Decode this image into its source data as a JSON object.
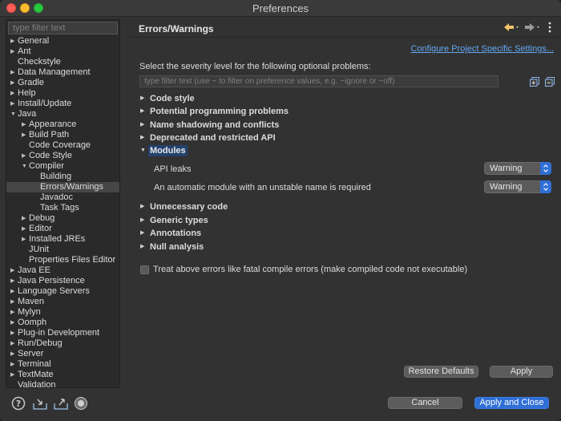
{
  "window": {
    "title": "Preferences"
  },
  "sidebar": {
    "filter_placeholder": "type filter text",
    "items": [
      {
        "label": "General",
        "arrow": "right"
      },
      {
        "label": "Ant",
        "arrow": "right"
      },
      {
        "label": "Checkstyle",
        "arrow": ""
      },
      {
        "label": "Data Management",
        "arrow": "right"
      },
      {
        "label": "Gradle",
        "arrow": "right"
      },
      {
        "label": "Help",
        "arrow": "right"
      },
      {
        "label": "Install/Update",
        "arrow": "right"
      },
      {
        "label": "Java",
        "arrow": "down"
      },
      {
        "label": "Appearance",
        "arrow": "right"
      },
      {
        "label": "Build Path",
        "arrow": "right"
      },
      {
        "label": "Code Coverage",
        "arrow": ""
      },
      {
        "label": "Code Style",
        "arrow": "right"
      },
      {
        "label": "Compiler",
        "arrow": "down"
      },
      {
        "label": "Building",
        "arrow": ""
      },
      {
        "label": "Errors/Warnings",
        "arrow": ""
      },
      {
        "label": "Javadoc",
        "arrow": ""
      },
      {
        "label": "Task Tags",
        "arrow": ""
      },
      {
        "label": "Debug",
        "arrow": "right"
      },
      {
        "label": "Editor",
        "arrow": "right"
      },
      {
        "label": "Installed JREs",
        "arrow": "right"
      },
      {
        "label": "JUnit",
        "arrow": ""
      },
      {
        "label": "Properties Files Editor",
        "arrow": ""
      },
      {
        "label": "Java EE",
        "arrow": "right"
      },
      {
        "label": "Java Persistence",
        "arrow": "right"
      },
      {
        "label": "Language Servers",
        "arrow": "right"
      },
      {
        "label": "Maven",
        "arrow": "right"
      },
      {
        "label": "Mylyn",
        "arrow": "right"
      },
      {
        "label": "Oomph",
        "arrow": "right"
      },
      {
        "label": "Plug-in Development",
        "arrow": "right"
      },
      {
        "label": "Run/Debug",
        "arrow": "right"
      },
      {
        "label": "Server",
        "arrow": "right"
      },
      {
        "label": "Terminal",
        "arrow": "right"
      },
      {
        "label": "TextMate",
        "arrow": "right"
      },
      {
        "label": "Validation",
        "arrow": ""
      }
    ]
  },
  "main": {
    "title": "Errors/Warnings",
    "config_link": "Configure Project Specific Settings...",
    "severity_text": "Select the severity level for the following optional problems:",
    "filter_placeholder": "type filter text (use ~ to filter on preference values, e.g. ~ignore or ~off)",
    "sections": [
      {
        "label": "Code style",
        "expanded": false
      },
      {
        "label": "Potential programming problems",
        "expanded": false
      },
      {
        "label": "Name shadowing and conflicts",
        "expanded": false
      },
      {
        "label": "Deprecated and restricted API",
        "expanded": false
      },
      {
        "label": "Modules",
        "expanded": true
      },
      {
        "label": "Unnecessary code",
        "expanded": false
      },
      {
        "label": "Generic types",
        "expanded": false
      },
      {
        "label": "Annotations",
        "expanded": false
      },
      {
        "label": "Null analysis",
        "expanded": false
      }
    ],
    "module_prefs": [
      {
        "label": "API leaks",
        "value": "Warning"
      },
      {
        "label": "An automatic module with an unstable name is required",
        "value": "Warning"
      }
    ],
    "fatal_checkbox_label": "Treat above errors like fatal compile errors (make compiled code not executable)",
    "fatal_checked": false,
    "restore_defaults": "Restore Defaults",
    "apply": "Apply"
  },
  "footer": {
    "cancel": "Cancel",
    "apply_close": "Apply and Close"
  },
  "colors": {
    "accent": "#2f6fd6",
    "link": "#62a8f5",
    "selection": "#24426e",
    "back_arrow": "#f0c36a"
  }
}
